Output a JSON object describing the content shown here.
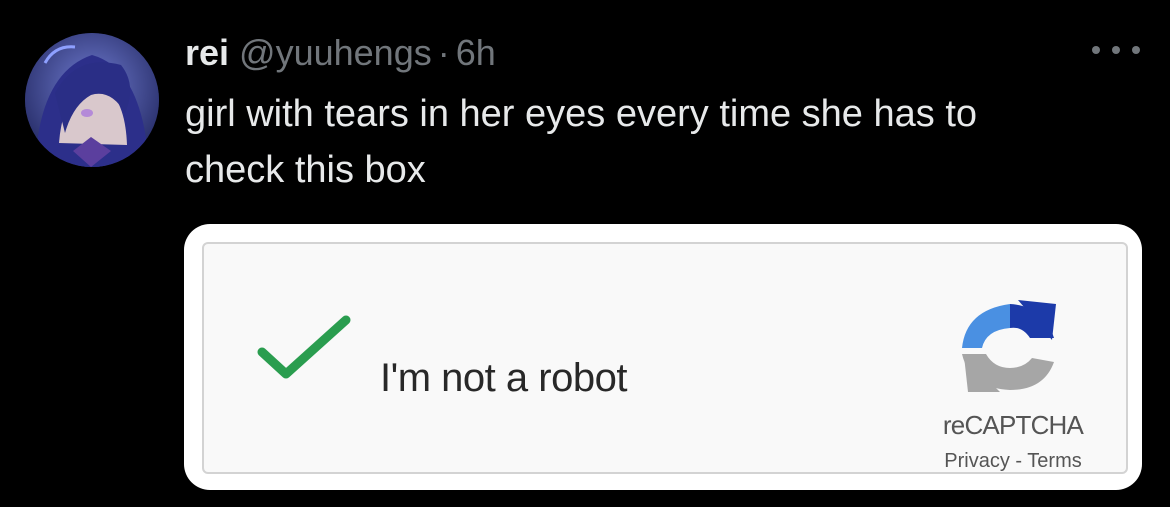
{
  "tweet": {
    "author_name": "rei",
    "handle": "@yuuhengs",
    "separator": "·",
    "time": "6h",
    "text_line1": "girl with tears in her eyes every time she has to",
    "text_line2": "check this box"
  },
  "captcha": {
    "label": "I'm not a robot",
    "checked": true,
    "brand": "reCAPTCHA",
    "privacy": "Privacy",
    "link_separator": "-",
    "terms": "Terms"
  },
  "icons": {
    "more": "more-horizontal-icon",
    "check": "checkmark-icon",
    "logo": "recaptcha-logo-icon"
  },
  "colors": {
    "background": "#000000",
    "primary_text": "#e7e9ea",
    "secondary_text": "#71767b",
    "check_green": "#2a9d4f",
    "recaptcha_blue_dark": "#1c3aa9",
    "recaptcha_blue_light": "#4a90e2",
    "recaptcha_gray": "#a6a6a6"
  }
}
